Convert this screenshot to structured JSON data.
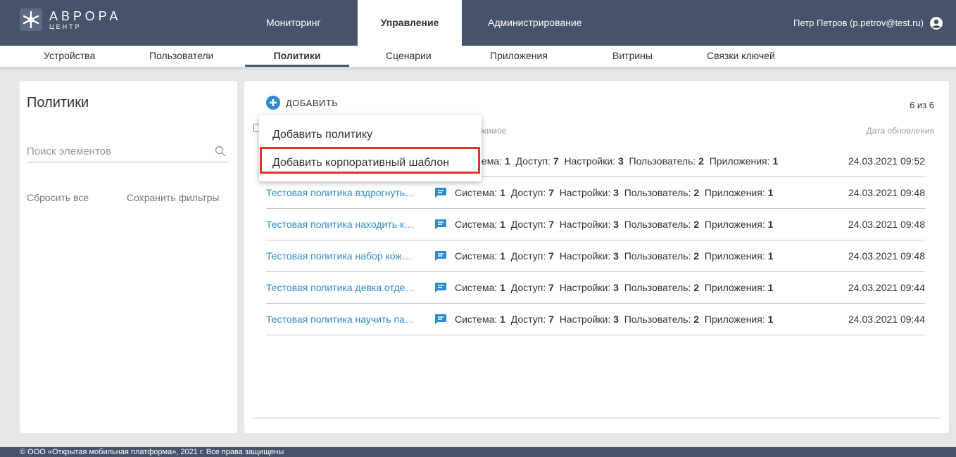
{
  "brand": {
    "title": "АВРОРА",
    "subtitle": "ЦЕНТР"
  },
  "main_tabs": [
    {
      "label": "Мониторинг"
    },
    {
      "label": "Управление"
    },
    {
      "label": "Администрирование"
    }
  ],
  "user": {
    "name": "Петр Петров (p.petrov@test.ru)",
    "icon": "user-icon"
  },
  "sub_tabs": [
    {
      "label": "Устройства"
    },
    {
      "label": "Пользователи"
    },
    {
      "label": "Политики"
    },
    {
      "label": "Сценарии"
    },
    {
      "label": "Приложения"
    },
    {
      "label": "Витрины"
    },
    {
      "label": "Связки ключей"
    }
  ],
  "filter_panel": {
    "title": "Политики",
    "search_placeholder": "Поиск элементов",
    "reset_label": "Сбросить все",
    "save_label": "Сохранить фильтры"
  },
  "toolbar": {
    "add_label": "ДОБАВИТЬ",
    "count": "6 из 6"
  },
  "table": {
    "header_content": "жимое",
    "header_date": "Дата обновления",
    "rows": [
      {
        "name": "",
        "system": "1",
        "access": "7",
        "settings": "3",
        "user": "2",
        "apps": "1",
        "date": "24.03.2021 09:52",
        "content_prefix": "ема: "
      },
      {
        "name": "Тестовая политика вздрогнуть…",
        "date": "24.03.2021 09:48"
      },
      {
        "name": "Тестовая политика находить к…",
        "date": "24.03.2021 09:48"
      },
      {
        "name": "Тестовая политика набор кож…",
        "date": "24.03.2021 09:48"
      },
      {
        "name": "Тестовая политика девка отде…",
        "date": "24.03.2021 09:44"
      },
      {
        "name": "Тестовая политика научить па…",
        "date": "24.03.2021 09:44"
      }
    ],
    "content_labels": {
      "system": "Система:",
      "system_val": "1",
      "access": "Доступ:",
      "access_val": "7",
      "settings": "Настройки:",
      "settings_val": "3",
      "user": "Пользователь:",
      "user_val": "2",
      "apps": "Приложения:",
      "apps_val": "1"
    }
  },
  "dropdown": {
    "items": [
      {
        "label": "Добавить политику"
      },
      {
        "label": "Добавить корпоративный шаблон"
      }
    ]
  },
  "footer": {
    "text": "© ООО «Открытая мобильная платформа», 2021 г. Все права защищены"
  },
  "colors": {
    "header_bg": "#46536a",
    "link": "#2e8ccd",
    "highlight": "#e53030"
  }
}
